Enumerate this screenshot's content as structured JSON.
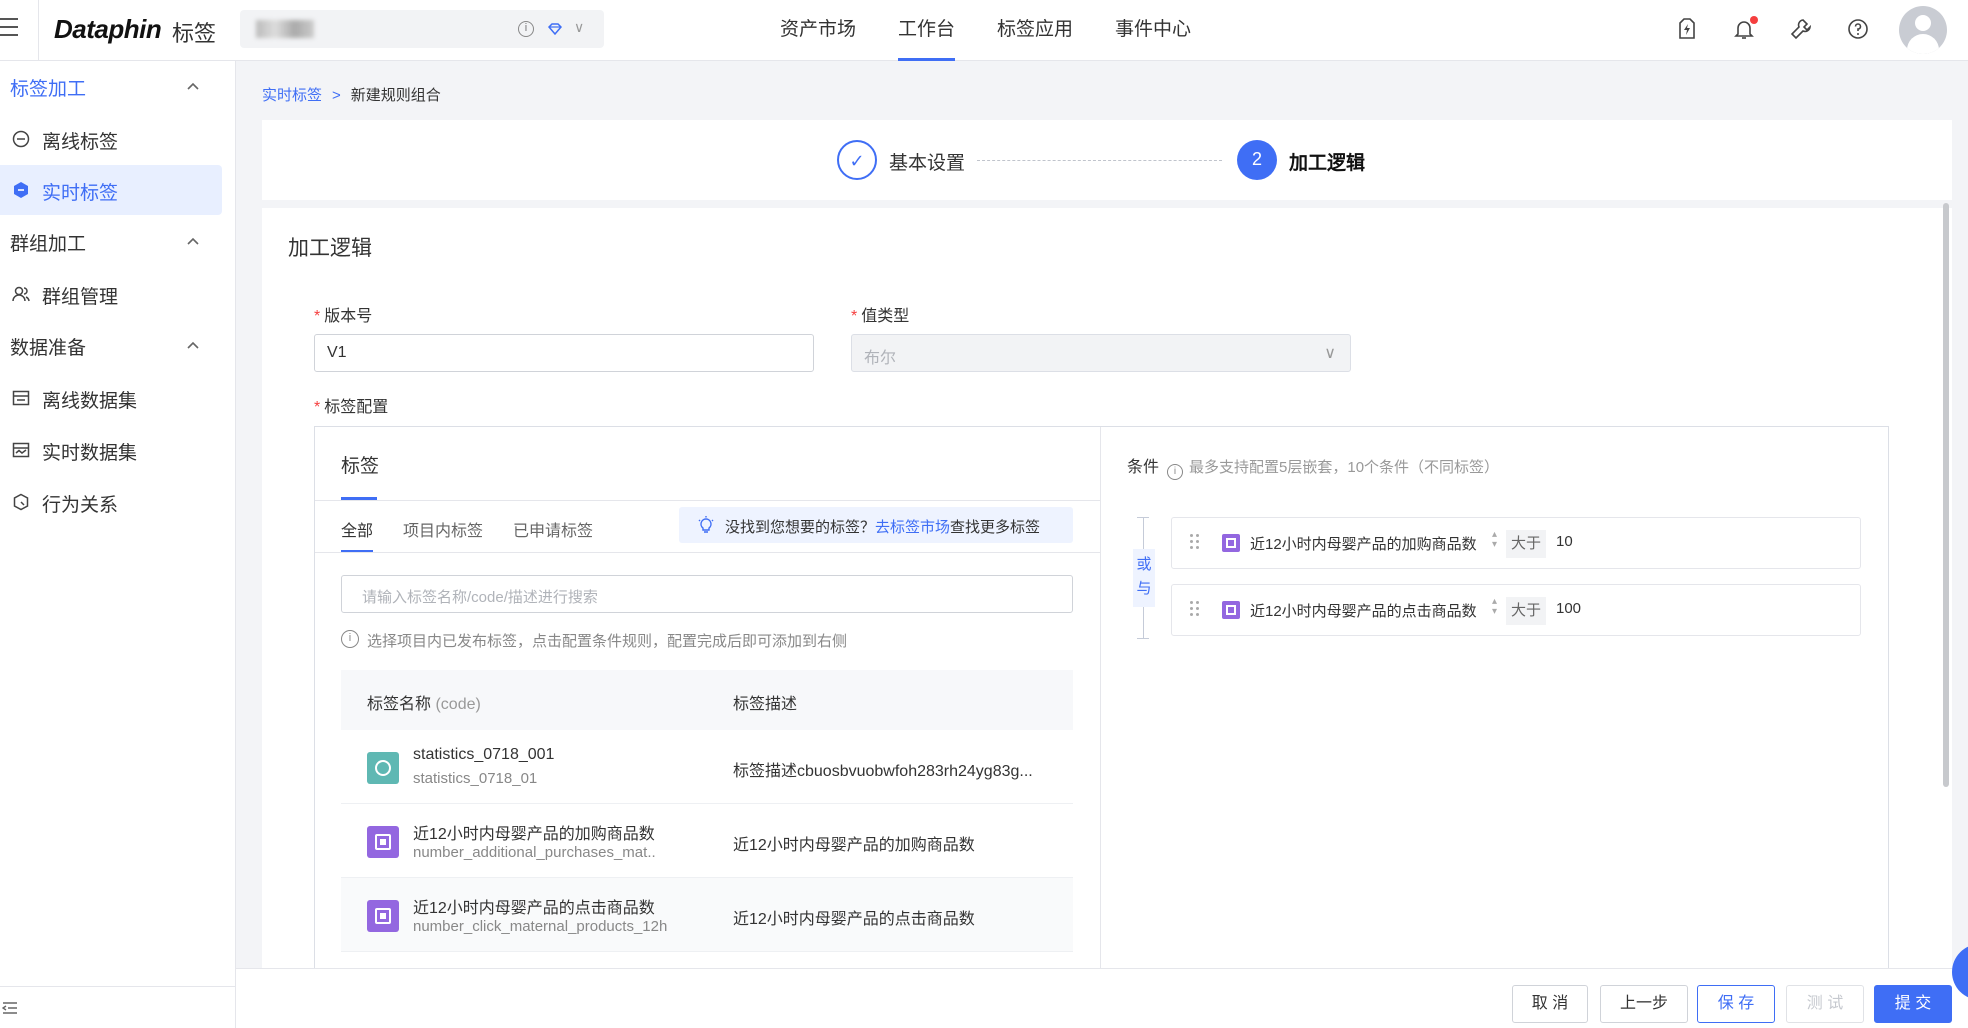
{
  "topbar": {
    "logo": "Dataphin",
    "logo_sub": "标签",
    "nav": [
      "资产市场",
      "工作台",
      "标签应用",
      "事件中心"
    ],
    "active_nav": "工作台"
  },
  "sidebar": {
    "groups": [
      {
        "label": "标签加工",
        "items": [
          "离线标签",
          "实时标签"
        ]
      },
      {
        "label": "群组加工",
        "items": [
          "群组管理"
        ]
      },
      {
        "label": "数据准备",
        "items": [
          "离线数据集",
          "实时数据集",
          "行为关系"
        ]
      }
    ],
    "active_item": "实时标签"
  },
  "breadcrumb": {
    "parent": "实时标签",
    "sep": ">",
    "current": "新建规则组合"
  },
  "steps": {
    "step1_label": "基本设置",
    "step1_icon": "✓",
    "step2_number": "2",
    "step2_label": "加工逻辑"
  },
  "section_title": "加工逻辑",
  "form": {
    "version_label": "版本号",
    "version_value": "V1",
    "value_type_label": "值类型",
    "value_type_value": "布尔",
    "config_label": "标签配置"
  },
  "tags_panel": {
    "header": "标签",
    "tabs": [
      "全部",
      "项目内标签",
      "已申请标签"
    ],
    "hint_text": "没找到您想要的标签？",
    "hint_link": "去标签市场",
    "hint_suffix": "查找更多标签",
    "search_placeholder": "请输入标签名称/code/描述进行搜索",
    "tip": "选择项目内已发布标签，点击配置条件规则，配置完成后即可添加到右侧",
    "col_name": "标签名称",
    "col_name_sub": "(code)",
    "col_desc": "标签描述",
    "rows": [
      {
        "name": "statistics_0718_001",
        "code": "statistics_0718_01",
        "desc": "标签描述cbuosbvuobwfoh283rh24yg83g..."
      },
      {
        "name": "近12小时内母婴产品的加购商品数",
        "code": "number_additional_purchases_mat..",
        "desc": "近12小时内母婴产品的加购商品数"
      },
      {
        "name": "近12小时内母婴产品的点击商品数",
        "code": "number_click_maternal_products_12h",
        "desc": "近12小时内母婴产品的点击商品数"
      }
    ]
  },
  "conditions": {
    "title": "条件",
    "subtitle": "最多支持配置5层嵌套，10个条件（不同标签）",
    "logic_or": "或",
    "logic_and": "与",
    "rows": [
      {
        "name": "近12小时内母婴产品的加购商品数",
        "op": "大于",
        "value": "10"
      },
      {
        "name": "近12小时内母婴产品的点击商品数",
        "op": "大于",
        "value": "100"
      }
    ]
  },
  "footer": {
    "cancel": "取 消",
    "prev": "上一步",
    "save": "保 存",
    "test": "测 试",
    "submit": "提 交"
  },
  "colors": {
    "primary": "#3f6ef5",
    "purple_icon": "#9367e0",
    "teal_icon": "#5fb8b3",
    "required": "#f53f3f"
  }
}
